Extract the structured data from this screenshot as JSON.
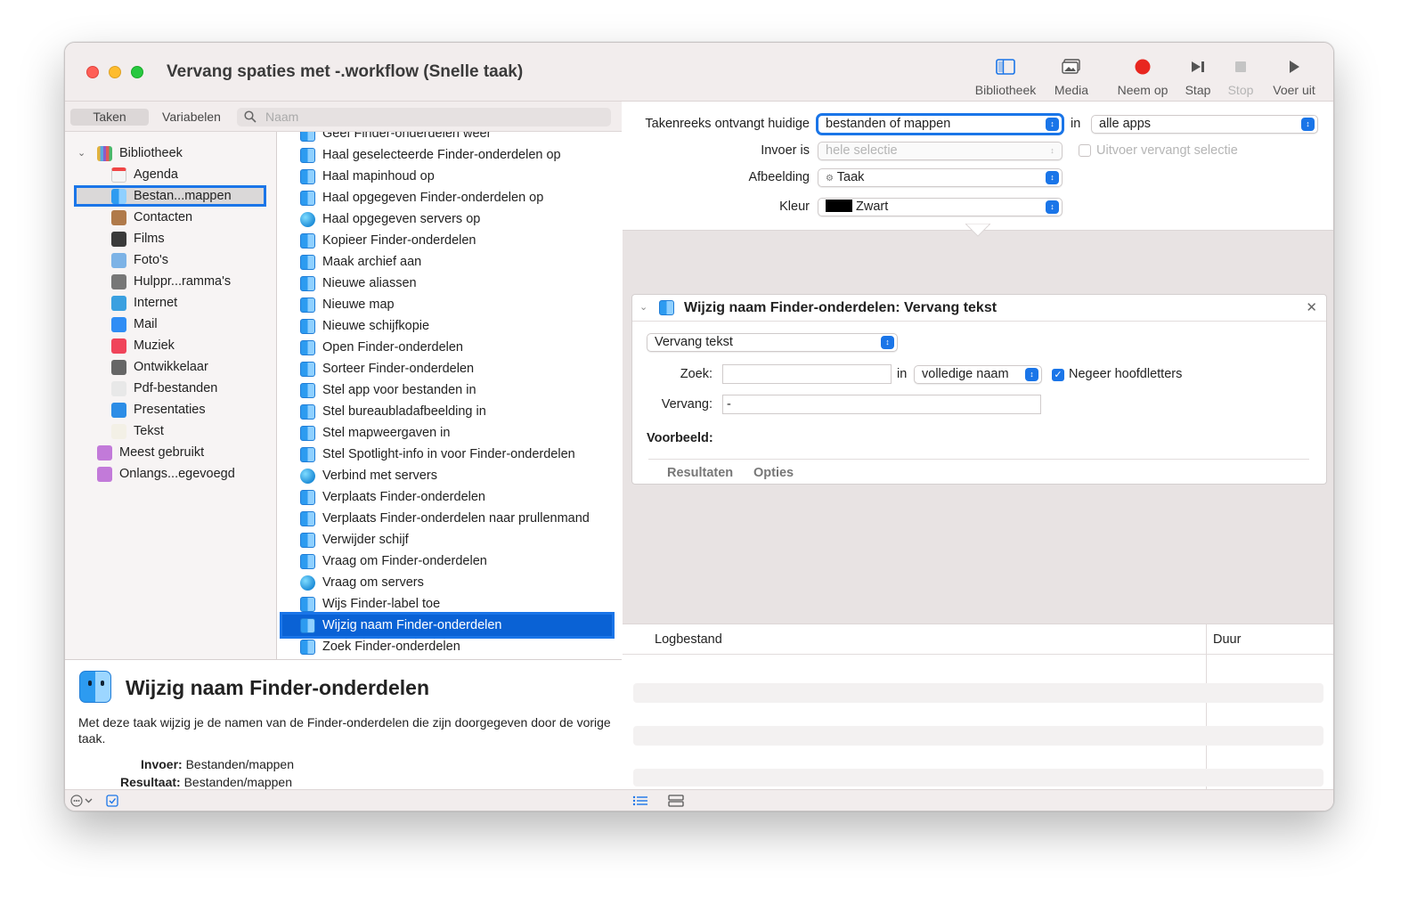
{
  "window": {
    "title": "Vervang spaties met -.workflow (Snelle taak)"
  },
  "toolbar": {
    "library": "Bibliotheek",
    "media": "Media",
    "record": "Neem op",
    "step": "Stap",
    "stop": "Stop",
    "run": "Voer uit"
  },
  "left": {
    "tab_actions": "Taken",
    "tab_variables": "Variabelen",
    "search_placeholder": "Naam"
  },
  "library": {
    "root": "Bibliotheek",
    "items": [
      {
        "label": "Agenda",
        "icon": "calendar-icon"
      },
      {
        "label": "Bestan...mappen",
        "icon": "finder-icon"
      },
      {
        "label": "Contacten",
        "icon": "contacts-icon"
      },
      {
        "label": "Films",
        "icon": "movies-icon"
      },
      {
        "label": "Foto's",
        "icon": "photos-icon"
      },
      {
        "label": "Hulppr...ramma's",
        "icon": "utilities-icon"
      },
      {
        "label": "Internet",
        "icon": "internet-icon"
      },
      {
        "label": "Mail",
        "icon": "mail-icon"
      },
      {
        "label": "Muziek",
        "icon": "music-icon"
      },
      {
        "label": "Ontwikkelaar",
        "icon": "developer-icon"
      },
      {
        "label": "Pdf-bestanden",
        "icon": "pdf-icon"
      },
      {
        "label": "Presentaties",
        "icon": "presentations-icon"
      },
      {
        "label": "Tekst",
        "icon": "text-icon"
      }
    ],
    "smart": [
      {
        "label": "Meest gebruikt",
        "icon": "smart-folder-icon"
      },
      {
        "label": "Onlangs...egevoegd",
        "icon": "smart-folder-icon"
      }
    ]
  },
  "actions": [
    {
      "label": "Geef Finder-onderdelen weer",
      "icon": "finder-icon"
    },
    {
      "label": "Haal geselecteerde Finder-onderdelen op",
      "icon": "finder-icon"
    },
    {
      "label": "Haal mapinhoud op",
      "icon": "finder-icon"
    },
    {
      "label": "Haal opgegeven Finder-onderdelen op",
      "icon": "finder-icon"
    },
    {
      "label": "Haal opgegeven servers op",
      "icon": "globe-icon"
    },
    {
      "label": "Kopieer Finder-onderdelen",
      "icon": "finder-icon"
    },
    {
      "label": "Maak archief aan",
      "icon": "finder-icon"
    },
    {
      "label": "Nieuwe aliassen",
      "icon": "finder-icon"
    },
    {
      "label": "Nieuwe map",
      "icon": "finder-icon"
    },
    {
      "label": "Nieuwe schijfkopie",
      "icon": "finder-icon"
    },
    {
      "label": "Open Finder-onderdelen",
      "icon": "finder-icon"
    },
    {
      "label": "Sorteer Finder-onderdelen",
      "icon": "finder-icon"
    },
    {
      "label": "Stel app voor bestanden in",
      "icon": "finder-icon"
    },
    {
      "label": "Stel bureaubladafbeelding in",
      "icon": "finder-icon"
    },
    {
      "label": "Stel mapweergaven in",
      "icon": "finder-icon"
    },
    {
      "label": "Stel Spotlight-info in voor Finder-onderdelen",
      "icon": "finder-icon"
    },
    {
      "label": "Verbind met servers",
      "icon": "globe-icon"
    },
    {
      "label": "Verplaats Finder-onderdelen",
      "icon": "finder-icon"
    },
    {
      "label": "Verplaats Finder-onderdelen naar prullenmand",
      "icon": "finder-icon"
    },
    {
      "label": "Verwijder schijf",
      "icon": "finder-icon"
    },
    {
      "label": "Vraag om Finder-onderdelen",
      "icon": "finder-icon"
    },
    {
      "label": "Vraag om servers",
      "icon": "globe-icon"
    },
    {
      "label": "Wijs Finder-label toe",
      "icon": "finder-icon"
    },
    {
      "label": "Wijzig naam Finder-onderdelen",
      "icon": "finder-icon"
    },
    {
      "label": "Zoek Finder-onderdelen",
      "icon": "finder-icon"
    }
  ],
  "description": {
    "title": "Wijzig naam Finder-onderdelen",
    "text": "Met deze taak wijzig je de namen van de Finder-onderdelen die zijn doorgegeven door de vorige taak.",
    "input_label": "Invoer:",
    "input_value": "Bestanden/mappen",
    "result_label": "Resultaat:",
    "result_value": "Bestanden/mappen"
  },
  "workflow": {
    "receives_label": "Takenreeks ontvangt huidige",
    "receives_value": "bestanden of mappen",
    "in_label": "in",
    "app_value": "alle apps",
    "input_label": "Invoer is",
    "input_value": "hele selectie",
    "output_replaces": "Uitvoer vervangt selectie",
    "image_label": "Afbeelding",
    "image_value": "Taak",
    "color_label": "Kleur",
    "color_value": "Zwart",
    "color_swatch": "#000000"
  },
  "action_box": {
    "title": "Wijzig naam Finder-onderdelen: Vervang tekst",
    "mode": "Vervang tekst",
    "find_label": "Zoek:",
    "find_value": "",
    "in_label": "in",
    "scope_value": "volledige naam",
    "ignore_case_label": "Negeer hoofdletters",
    "ignore_case_checked": true,
    "replace_label": "Vervang:",
    "replace_value": "-",
    "preview_label": "Voorbeeld:",
    "tab_results": "Resultaten",
    "tab_options": "Opties"
  },
  "log": {
    "col_log": "Logbestand",
    "col_duration": "Duur"
  },
  "colors": {
    "accent": "#1a75e8",
    "record": "#e8261f"
  }
}
